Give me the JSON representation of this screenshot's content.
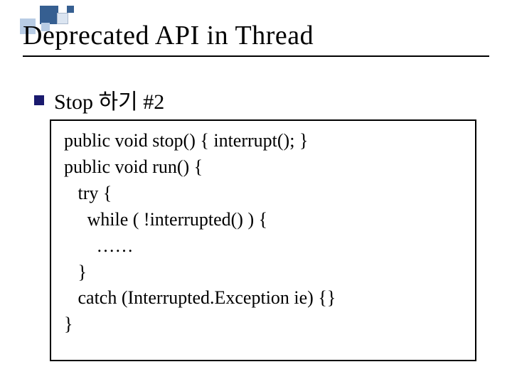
{
  "title": "Deprecated API in Thread",
  "bullet": "Stop 하기 #2",
  "code": {
    "l1": "public void stop() { interrupt(); }",
    "l2": "public void run() {",
    "l3": "   try {",
    "l4": "     while ( !interrupted() ) {",
    "l5": "       ……",
    "l6": "   }",
    "l7": "   catch (Interrupted.Exception ie) {}",
    "l8": "}"
  }
}
